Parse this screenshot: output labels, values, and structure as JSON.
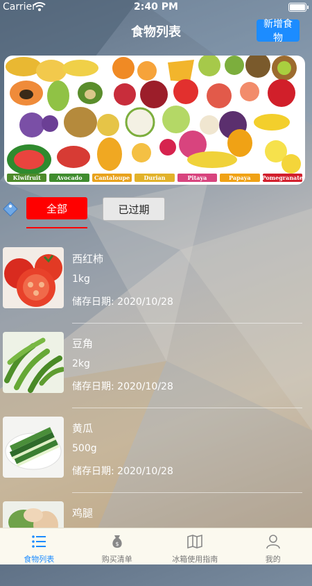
{
  "status_bar": {
    "carrier": "Carrier",
    "time": "2:40 PM"
  },
  "header": {
    "title": "食物列表",
    "add_button": "新增食物"
  },
  "banner": {
    "fruits": [
      "Kiwifruit",
      "Avocado",
      "Cantaloupe",
      "Durian",
      "Pitaya",
      "Papaya",
      "Pomegranate"
    ],
    "fruit_colors": [
      "#4e8b2b",
      "#3f8c2e",
      "#e8a21c",
      "#e2b22a",
      "#d8447e",
      "#f0a215",
      "#d21f2c"
    ],
    "doodle_words": [
      "orange",
      "peach",
      "apple",
      "watermelon",
      "lemon",
      "banana",
      "pineapple"
    ]
  },
  "tabs": {
    "all": "全部",
    "expired": "已过期",
    "active": "all"
  },
  "colors": {
    "accent_red": "#ff0000",
    "accent_blue": "#1c8cff"
  },
  "foods": [
    {
      "name": "西红柿",
      "quantity": "1kg",
      "date": "储存日期: 2020/10/28"
    },
    {
      "name": "豆角",
      "quantity": "2kg",
      "date": "储存日期: 2020/10/28"
    },
    {
      "name": "黄瓜",
      "quantity": "500g",
      "date": "储存日期: 2020/10/28"
    },
    {
      "name": "鸡腿",
      "quantity": "",
      "date": ""
    }
  ],
  "tabbar": [
    {
      "label": "食物列表",
      "icon": "list-icon",
      "active": true
    },
    {
      "label": "购买清单",
      "icon": "money-bag-icon",
      "active": false
    },
    {
      "label": "冰箱使用指南",
      "icon": "book-icon",
      "active": false
    },
    {
      "label": "我的",
      "icon": "person-icon",
      "active": false
    }
  ]
}
